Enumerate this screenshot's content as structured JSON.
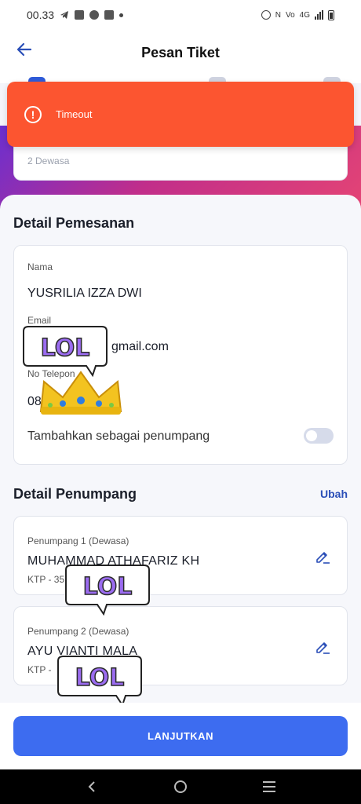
{
  "status_bar": {
    "time": "00.33",
    "network": "4G"
  },
  "header": {
    "title": "Pesan Tiket"
  },
  "toast": {
    "message": "Timeout"
  },
  "passenger_summary": {
    "text": "2 Dewasa"
  },
  "booking_details": {
    "title": "Detail Pemesanan",
    "name_label": "Nama",
    "name_value": "YUSRILIA IZZA DWI",
    "email_label": "Email",
    "email_value": "gmail.com",
    "phone_label": "No Telepon",
    "phone_value": "08",
    "add_passenger_label": "Tambahkan sebagai penumpang",
    "add_passenger_toggle": false
  },
  "passenger_details": {
    "title": "Detail Penumpang",
    "edit_link": "Ubah",
    "passengers": [
      {
        "label": "Penumpang 1 (Dewasa)",
        "name": "MUHAMMAD ATHAFARIZ KH",
        "id": "KTP - 35"
      },
      {
        "label": "Penumpang 2 (Dewasa)",
        "name": "AYU VIANTI MALA",
        "id": "KTP -"
      }
    ]
  },
  "stickers": {
    "text": "LOL"
  },
  "footer": {
    "continue_label": "LANJUTKAN"
  },
  "colors": {
    "primary": "#3d6cf0",
    "toast": "#fc5530",
    "link": "#2b4fb8"
  }
}
